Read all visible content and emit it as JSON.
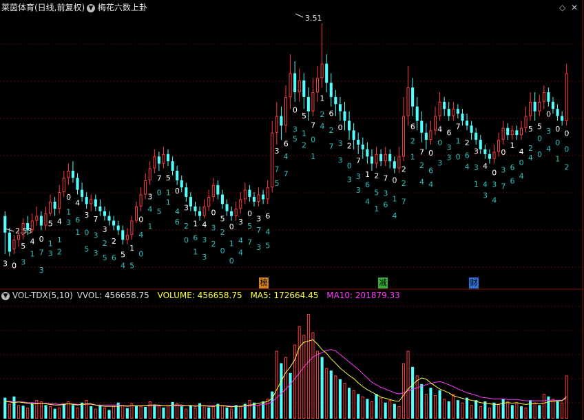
{
  "title_bar": {
    "stock_name": "莱茵体育(日线,前复权)",
    "indicator_name": "梅花六数上卦",
    "dropdown_icon": "chevron-down-icon",
    "corner_icon": "diamond-icon",
    "close_icon": "close-icon"
  },
  "price_panel": {
    "high_label": "3.51",
    "low_label": "2.53",
    "event_markers": [
      {
        "text": "榜",
        "color": "#d08020"
      },
      {
        "text": "减",
        "color": "#3aa83a"
      },
      {
        "text": "财",
        "color": "#2f6fd0"
      }
    ]
  },
  "volume_panel": {
    "name": "VOL-TDX(5,10)",
    "vvol": "VVOL: 456658.75",
    "volume": "VOLUME: 456658.75",
    "ma5": "MA5: 172664.45",
    "ma10": "MA10: 201879.33",
    "colors": {
      "vvol": "#dddddd",
      "volume": "#ffff3c",
      "ma5": "#ffff3c",
      "ma10": "#ff3cff"
    }
  },
  "chart_data": {
    "type": "candlestick",
    "price_range": [
      2.45,
      3.55
    ],
    "candles": [
      [
        2.7,
        2.63,
        2.72,
        2.54,
        0
      ],
      [
        2.63,
        2.55,
        2.65,
        2.53,
        0
      ],
      [
        2.56,
        2.6,
        2.62,
        2.54,
        1
      ],
      [
        2.6,
        2.62,
        2.65,
        2.57,
        1
      ],
      [
        2.62,
        2.67,
        2.69,
        2.6,
        1
      ],
      [
        2.67,
        2.64,
        2.7,
        2.62,
        0
      ],
      [
        2.64,
        2.68,
        2.71,
        2.63,
        1
      ],
      [
        2.68,
        2.7,
        2.74,
        2.66,
        1
      ],
      [
        2.7,
        2.66,
        2.72,
        2.64,
        0
      ],
      [
        2.66,
        2.71,
        2.74,
        2.64,
        1
      ],
      [
        2.71,
        2.76,
        2.79,
        2.7,
        1
      ],
      [
        2.76,
        2.73,
        2.78,
        2.7,
        0
      ],
      [
        2.73,
        2.8,
        2.83,
        2.71,
        1
      ],
      [
        2.8,
        2.86,
        2.89,
        2.78,
        1
      ],
      [
        2.86,
        2.89,
        2.92,
        2.83,
        1
      ],
      [
        2.89,
        2.86,
        2.93,
        2.84,
        0
      ],
      [
        2.86,
        2.81,
        2.88,
        2.79,
        0
      ],
      [
        2.81,
        2.78,
        2.84,
        2.76,
        0
      ],
      [
        2.78,
        2.75,
        2.8,
        2.73,
        0
      ],
      [
        2.75,
        2.77,
        2.79,
        2.72,
        1
      ],
      [
        2.77,
        2.74,
        2.79,
        2.72,
        0
      ],
      [
        2.74,
        2.72,
        2.77,
        2.7,
        0
      ],
      [
        2.72,
        2.7,
        2.74,
        2.68,
        0
      ],
      [
        2.7,
        2.68,
        2.72,
        2.66,
        0
      ],
      [
        2.68,
        2.66,
        2.7,
        2.64,
        0
      ],
      [
        2.66,
        2.64,
        2.68,
        2.62,
        0
      ],
      [
        2.64,
        2.6,
        2.66,
        2.58,
        0
      ],
      [
        2.6,
        2.62,
        2.65,
        2.58,
        1
      ],
      [
        2.62,
        2.68,
        2.7,
        2.6,
        1
      ],
      [
        2.68,
        2.74,
        2.76,
        2.67,
        1
      ],
      [
        2.74,
        2.79,
        2.82,
        2.72,
        1
      ],
      [
        2.79,
        2.85,
        2.88,
        2.77,
        1
      ],
      [
        2.85,
        2.9,
        2.93,
        2.83,
        1
      ],
      [
        2.9,
        2.95,
        2.98,
        2.88,
        1
      ],
      [
        2.95,
        2.92,
        2.97,
        2.89,
        0
      ],
      [
        2.92,
        2.96,
        2.99,
        2.9,
        1
      ],
      [
        2.96,
        2.93,
        2.98,
        2.91,
        0
      ],
      [
        2.93,
        2.89,
        2.95,
        2.87,
        0
      ],
      [
        2.89,
        2.85,
        2.91,
        2.83,
        0
      ],
      [
        2.85,
        2.82,
        2.87,
        2.8,
        0
      ],
      [
        2.82,
        2.78,
        2.84,
        2.76,
        0
      ],
      [
        2.78,
        2.74,
        2.8,
        2.72,
        0
      ],
      [
        2.74,
        2.72,
        2.76,
        2.7,
        0
      ],
      [
        2.72,
        2.7,
        2.74,
        2.68,
        0
      ],
      [
        2.7,
        2.74,
        2.77,
        2.69,
        1
      ],
      [
        2.74,
        2.78,
        2.81,
        2.72,
        1
      ],
      [
        2.78,
        2.83,
        2.86,
        2.76,
        1
      ],
      [
        2.83,
        2.79,
        2.85,
        2.77,
        0
      ],
      [
        2.79,
        2.75,
        2.81,
        2.73,
        0
      ],
      [
        2.75,
        2.72,
        2.77,
        2.7,
        0
      ],
      [
        2.72,
        2.7,
        2.74,
        2.68,
        0
      ],
      [
        2.7,
        2.73,
        2.76,
        2.68,
        1
      ],
      [
        2.73,
        2.77,
        2.8,
        2.71,
        1
      ],
      [
        2.77,
        2.81,
        2.84,
        2.75,
        1
      ],
      [
        2.81,
        2.78,
        2.83,
        2.76,
        0
      ],
      [
        2.78,
        2.76,
        2.8,
        2.74,
        0
      ],
      [
        2.76,
        2.79,
        2.82,
        2.74,
        1
      ],
      [
        2.79,
        2.77,
        2.81,
        2.75,
        0
      ],
      [
        2.77,
        2.82,
        2.85,
        2.75,
        1
      ],
      [
        2.82,
        3.05,
        3.1,
        2.8,
        1
      ],
      [
        3.05,
        3.12,
        3.18,
        3.0,
        1
      ],
      [
        3.12,
        3.08,
        3.16,
        3.02,
        0
      ],
      [
        3.08,
        3.2,
        3.25,
        3.05,
        1
      ],
      [
        3.2,
        3.3,
        3.38,
        3.15,
        1
      ],
      [
        3.3,
        3.22,
        3.35,
        3.18,
        0
      ],
      [
        3.22,
        3.27,
        3.32,
        3.18,
        1
      ],
      [
        3.27,
        3.2,
        3.3,
        3.15,
        0
      ],
      [
        3.2,
        3.14,
        3.24,
        3.1,
        0
      ],
      [
        3.14,
        3.22,
        3.28,
        3.12,
        1
      ],
      [
        3.22,
        3.28,
        3.33,
        3.18,
        1
      ],
      [
        3.28,
        3.34,
        3.51,
        3.24,
        1
      ],
      [
        3.34,
        3.26,
        3.38,
        3.22,
        0
      ],
      [
        3.26,
        3.2,
        3.3,
        3.16,
        0
      ],
      [
        3.2,
        3.17,
        3.23,
        3.12,
        0
      ],
      [
        3.17,
        3.14,
        3.2,
        3.1,
        0
      ],
      [
        3.14,
        3.1,
        3.18,
        3.06,
        0
      ],
      [
        3.1,
        3.06,
        3.14,
        3.02,
        0
      ],
      [
        3.06,
        3.02,
        3.09,
        2.98,
        0
      ],
      [
        3.02,
        3.0,
        3.05,
        2.96,
        0
      ],
      [
        3.0,
        2.98,
        3.03,
        2.94,
        0
      ],
      [
        2.98,
        2.95,
        3.01,
        2.92,
        0
      ],
      [
        2.95,
        2.92,
        2.98,
        2.89,
        0
      ],
      [
        2.92,
        2.96,
        2.99,
        2.9,
        1
      ],
      [
        2.96,
        2.93,
        2.98,
        2.91,
        0
      ],
      [
        2.93,
        2.96,
        2.99,
        2.91,
        1
      ],
      [
        2.96,
        2.93,
        2.98,
        2.9,
        0
      ],
      [
        2.93,
        2.9,
        2.95,
        2.88,
        0
      ],
      [
        2.9,
        2.95,
        2.99,
        2.88,
        1
      ],
      [
        2.95,
        3.12,
        3.2,
        2.93,
        1
      ],
      [
        3.12,
        3.24,
        3.33,
        3.08,
        1
      ],
      [
        3.24,
        3.16,
        3.28,
        3.12,
        0
      ],
      [
        3.16,
        3.1,
        3.2,
        3.06,
        0
      ],
      [
        3.1,
        3.05,
        3.14,
        3.01,
        0
      ],
      [
        3.05,
        3.02,
        3.09,
        2.98,
        0
      ],
      [
        3.02,
        3.06,
        3.1,
        3.0,
        1
      ],
      [
        3.06,
        3.12,
        3.16,
        3.04,
        1
      ],
      [
        3.12,
        3.18,
        3.22,
        3.1,
        1
      ],
      [
        3.18,
        3.15,
        3.2,
        3.12,
        0
      ],
      [
        3.15,
        3.12,
        3.18,
        3.1,
        0
      ],
      [
        3.12,
        3.15,
        3.18,
        3.1,
        1
      ],
      [
        3.15,
        3.13,
        3.17,
        3.11,
        0
      ],
      [
        3.13,
        3.1,
        3.15,
        3.08,
        0
      ],
      [
        3.1,
        3.08,
        3.13,
        3.06,
        0
      ],
      [
        3.08,
        3.05,
        3.1,
        3.02,
        0
      ],
      [
        3.05,
        3.02,
        3.07,
        3.0,
        0
      ],
      [
        3.02,
        2.98,
        3.04,
        2.96,
        0
      ],
      [
        2.98,
        2.96,
        3.0,
        2.94,
        0
      ],
      [
        2.96,
        2.94,
        2.98,
        2.92,
        0
      ],
      [
        2.94,
        2.97,
        3.0,
        2.92,
        1
      ],
      [
        2.97,
        3.02,
        3.05,
        2.95,
        1
      ],
      [
        3.02,
        3.07,
        3.1,
        3.0,
        1
      ],
      [
        3.07,
        3.04,
        3.09,
        3.02,
        0
      ],
      [
        3.04,
        3.06,
        3.08,
        3.02,
        1
      ],
      [
        3.06,
        3.04,
        3.08,
        3.02,
        0
      ],
      [
        3.04,
        3.07,
        3.1,
        3.02,
        1
      ],
      [
        3.07,
        3.12,
        3.16,
        3.05,
        1
      ],
      [
        3.12,
        3.18,
        3.22,
        3.1,
        1
      ],
      [
        3.18,
        3.14,
        3.22,
        3.1,
        0
      ],
      [
        3.14,
        3.18,
        3.21,
        3.12,
        1
      ],
      [
        3.18,
        3.22,
        3.25,
        3.15,
        1
      ],
      [
        3.22,
        3.18,
        3.24,
        3.16,
        0
      ],
      [
        3.18,
        3.15,
        3.2,
        3.13,
        0
      ],
      [
        3.15,
        3.12,
        3.17,
        3.1,
        0
      ],
      [
        3.12,
        3.1,
        3.14,
        3.08,
        0
      ],
      [
        3.1,
        3.3,
        3.34,
        3.08,
        1
      ]
    ],
    "volumes": [
      [
        34,
        0
      ],
      [
        24,
        1
      ],
      [
        36,
        0
      ],
      [
        22,
        1
      ],
      [
        21,
        0
      ],
      [
        18,
        1
      ],
      [
        25,
        0
      ],
      [
        30,
        1
      ],
      [
        28,
        1
      ],
      [
        22,
        0
      ],
      [
        20,
        1
      ],
      [
        16,
        0
      ],
      [
        18,
        1
      ],
      [
        24,
        0
      ],
      [
        28,
        1
      ],
      [
        22,
        0
      ],
      [
        18,
        1
      ],
      [
        26,
        0
      ],
      [
        30,
        1
      ],
      [
        20,
        0
      ],
      [
        16,
        1
      ],
      [
        22,
        0
      ],
      [
        18,
        1
      ],
      [
        14,
        0
      ],
      [
        20,
        1
      ],
      [
        26,
        0
      ],
      [
        22,
        1
      ],
      [
        17,
        0
      ],
      [
        25,
        1
      ],
      [
        21,
        0
      ],
      [
        20,
        1
      ],
      [
        19,
        0
      ],
      [
        28,
        1
      ],
      [
        23,
        0
      ],
      [
        21,
        1
      ],
      [
        18,
        0
      ],
      [
        21,
        1
      ],
      [
        27,
        0
      ],
      [
        25,
        1
      ],
      [
        20,
        0
      ],
      [
        16,
        1
      ],
      [
        22,
        0
      ],
      [
        18,
        1
      ],
      [
        25,
        0
      ],
      [
        21,
        1
      ],
      [
        18,
        0
      ],
      [
        20,
        1
      ],
      [
        24,
        0
      ],
      [
        22,
        1
      ],
      [
        18,
        0
      ],
      [
        16,
        1
      ],
      [
        22,
        0
      ],
      [
        20,
        1
      ],
      [
        24,
        0
      ],
      [
        30,
        1
      ],
      [
        26,
        0
      ],
      [
        22,
        1
      ],
      [
        28,
        0
      ],
      [
        32,
        1
      ],
      [
        44,
        0
      ],
      [
        110,
        1
      ],
      [
        90,
        0
      ],
      [
        100,
        1
      ],
      [
        74,
        0
      ],
      [
        120,
        1
      ],
      [
        150,
        1
      ],
      [
        136,
        1
      ],
      [
        170,
        1
      ],
      [
        140,
        1
      ],
      [
        110,
        1
      ],
      [
        100,
        0
      ],
      [
        82,
        1
      ],
      [
        78,
        0
      ],
      [
        70,
        1
      ],
      [
        64,
        0
      ],
      [
        58,
        1
      ],
      [
        50,
        0
      ],
      [
        46,
        1
      ],
      [
        40,
        0
      ],
      [
        36,
        1
      ],
      [
        32,
        0
      ],
      [
        28,
        1
      ],
      [
        40,
        0
      ],
      [
        34,
        1
      ],
      [
        26,
        0
      ],
      [
        30,
        1
      ],
      [
        24,
        0
      ],
      [
        20,
        1
      ],
      [
        90,
        1
      ],
      [
        110,
        1
      ],
      [
        84,
        0
      ],
      [
        70,
        1
      ],
      [
        56,
        0
      ],
      [
        40,
        1
      ],
      [
        50,
        0
      ],
      [
        38,
        1
      ],
      [
        46,
        0
      ],
      [
        32,
        1
      ],
      [
        28,
        0
      ],
      [
        40,
        1
      ],
      [
        30,
        0
      ],
      [
        26,
        1
      ],
      [
        34,
        0
      ],
      [
        22,
        1
      ],
      [
        30,
        0
      ],
      [
        20,
        1
      ],
      [
        28,
        0
      ],
      [
        18,
        1
      ],
      [
        26,
        0
      ],
      [
        24,
        1
      ],
      [
        32,
        0
      ],
      [
        28,
        1
      ],
      [
        22,
        0
      ],
      [
        26,
        1
      ],
      [
        20,
        0
      ],
      [
        18,
        1
      ],
      [
        30,
        0
      ],
      [
        26,
        1
      ],
      [
        22,
        0
      ],
      [
        40,
        1
      ],
      [
        36,
        0
      ],
      [
        32,
        1
      ],
      [
        28,
        0
      ],
      [
        26,
        1
      ],
      [
        70,
        1
      ]
    ],
    "vol_ma5": [
      28,
      27,
      26,
      27,
      26,
      25,
      24,
      24,
      25,
      24,
      23,
      22,
      22,
      23,
      24,
      23,
      22,
      23,
      24,
      24,
      22,
      21,
      20,
      20,
      20,
      20,
      21,
      20,
      21,
      21,
      21,
      21,
      22,
      22,
      22,
      21,
      21,
      22,
      22,
      22,
      21,
      21,
      20,
      21,
      21,
      20,
      20,
      21,
      21,
      20,
      19,
      20,
      20,
      21,
      22,
      23,
      25,
      26,
      28,
      33,
      47,
      61,
      75,
      84,
      96,
      116,
      124,
      126,
      128,
      121,
      112,
      106,
      97,
      90,
      82,
      76,
      70,
      65,
      58,
      52,
      47,
      43,
      39,
      35,
      33,
      31,
      29,
      28,
      38,
      48,
      55,
      62,
      66,
      64,
      58,
      53,
      48,
      45,
      42,
      37,
      35,
      33,
      31,
      30,
      28,
      26,
      25,
      24,
      23,
      23,
      25,
      26,
      25,
      26,
      24,
      23,
      24,
      25,
      24,
      25,
      27,
      28,
      29,
      29,
      36
    ],
    "vol_ma10": [
      28,
      28,
      27,
      27,
      27,
      26,
      26,
      25,
      25,
      25,
      24,
      24,
      23,
      24,
      24,
      24,
      23,
      23,
      23,
      23,
      22,
      22,
      22,
      22,
      22,
      22,
      21,
      21,
      21,
      21,
      21,
      21,
      21,
      21,
      21,
      21,
      21,
      21,
      21,
      21,
      21,
      21,
      21,
      21,
      21,
      21,
      21,
      21,
      21,
      21,
      20,
      20,
      20,
      20,
      21,
      21,
      22,
      23,
      24,
      27,
      34,
      41,
      48,
      56,
      65,
      74,
      84,
      92,
      100,
      104,
      107,
      111,
      112,
      110,
      104,
      98,
      92,
      86,
      80,
      73,
      66,
      59,
      55,
      51,
      48,
      45,
      42,
      40,
      42,
      45,
      48,
      50,
      53,
      55,
      57,
      59,
      60,
      58,
      55,
      52,
      48,
      45,
      42,
      40,
      38,
      35,
      34,
      33,
      32,
      32,
      32,
      31,
      31,
      31,
      30,
      29,
      29,
      29,
      29,
      29,
      30,
      30,
      30,
      30,
      33
    ]
  }
}
